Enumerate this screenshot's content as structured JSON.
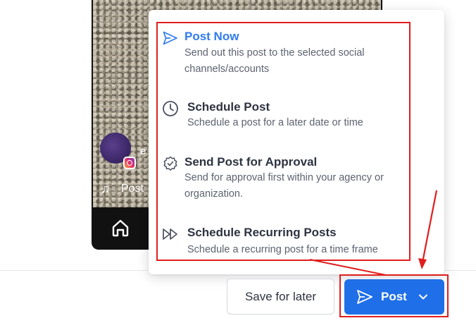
{
  "preview": {
    "account_text": "e",
    "music_text": "Post"
  },
  "menu": {
    "items": [
      {
        "title": "Post Now",
        "description": "Send out this post to the selected social channels/accounts",
        "icon": "send-icon"
      },
      {
        "title": "Schedule Post",
        "description": "Schedule a post for a later date or time",
        "icon": "clock-icon"
      },
      {
        "title": "Send Post for Approval",
        "description": "Send for approval first within your agency or organization.",
        "icon": "badge-check-icon"
      },
      {
        "title": "Schedule Recurring Posts",
        "description": "Schedule a recurring post for a time frame",
        "icon": "fast-forward-icon"
      }
    ]
  },
  "footer": {
    "save_label": "Save for later",
    "post_label": "Post"
  },
  "colors": {
    "accent": "#1f6fe8",
    "active_item": "#2f7bef",
    "annotation": "#e01e1e"
  }
}
